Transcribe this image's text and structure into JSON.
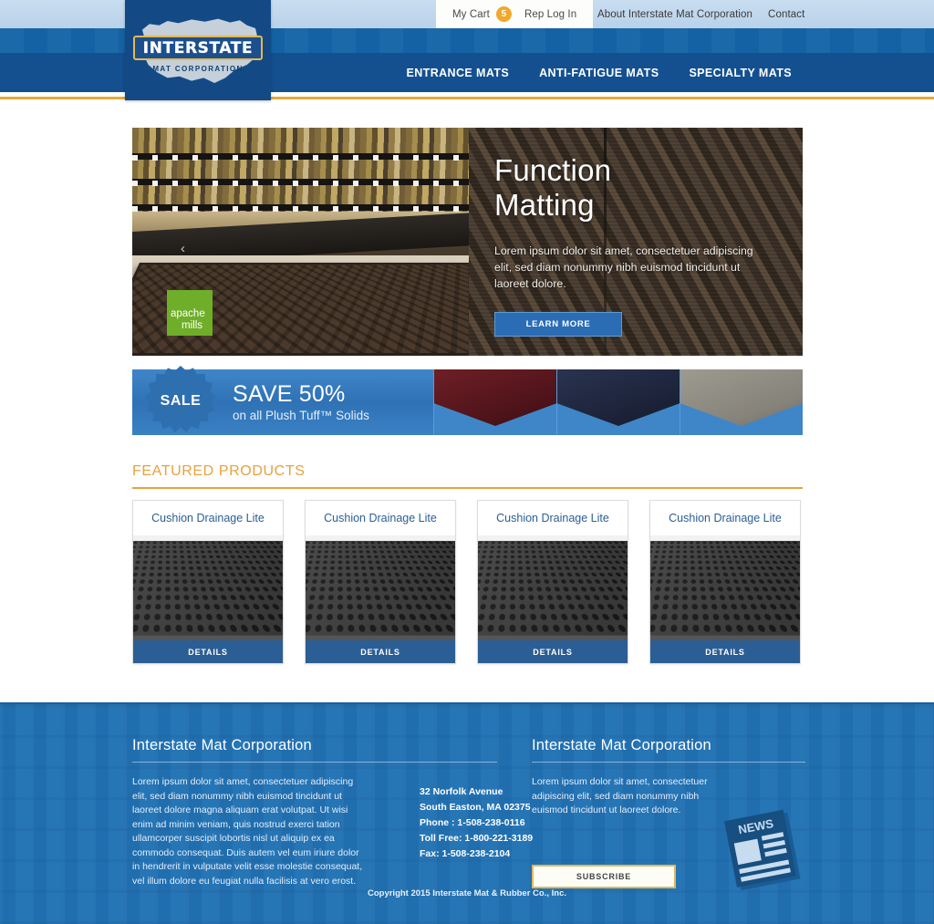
{
  "brand": {
    "logo_word": "INTERSTATE",
    "logo_sub": "MAT CORPORATION"
  },
  "colors": {
    "header_light": "#bfd6ec",
    "header_mid": "#1565a8",
    "nav_blue": "#14508f",
    "gold_rule": "#e8a93a",
    "accent_orange": "#e9a13b",
    "button_blue": "#2b5e94",
    "footer_blue": "#2272b4",
    "cart_badge": "#f0a92b"
  },
  "utility_nav": {
    "cart_label": "My Cart",
    "cart_count": "5",
    "rep_login": "Rep Log In",
    "about": "About Interstate Mat Corporation",
    "contact": "Contact"
  },
  "main_nav": {
    "items": [
      {
        "label": "ENTRANCE MATS"
      },
      {
        "label": "ANTI-FATIGUE MATS"
      },
      {
        "label": "SPECIALTY MATS"
      }
    ]
  },
  "hero": {
    "title_line1": "Function",
    "title_line2": "Matting",
    "description": "Lorem ipsum dolor sit amet, consectetuer adipiscing elit, sed diam nonummy nibh euismod tincidunt ut laoreet dolore.",
    "cta_label": "LEARN MORE",
    "prev_arrow": "‹",
    "partner_logo_line1": "apache",
    "partner_logo_line2": "mills"
  },
  "sale_banner": {
    "badge": "SALE",
    "headline": "SAVE 50%",
    "subline": "on all Plush Tuff™ Solids",
    "swatches": [
      {
        "name": "maroon-mat-swatch"
      },
      {
        "name": "navy-mat-swatch"
      },
      {
        "name": "gray-mat-swatch"
      }
    ]
  },
  "featured": {
    "title": "FEATURED PRODUCTS",
    "products": [
      {
        "name": "Cushion Drainage Lite",
        "button": "DETAILS"
      },
      {
        "name": "Cushion Drainage Lite",
        "button": "DETAILS"
      },
      {
        "name": "Cushion Drainage Lite",
        "button": "DETAILS"
      },
      {
        "name": "Cushion Drainage Lite",
        "button": "DETAILS"
      }
    ]
  },
  "footer": {
    "left": {
      "heading": "Interstate Mat Corporation",
      "body": "Lorem ipsum dolor sit amet, consectetuer adipiscing elit, sed diam nonummy nibh euismod tincidunt ut laoreet dolore magna aliquam erat volutpat. Ut wisi enim ad minim veniam, quis nostrud exerci tation ullamcorper suscipit lobortis nisl ut aliquip ex ea commodo consequat. Duis autem vel eum iriure dolor in hendrerit in vulputate velit esse molestie consequat, vel illum dolore eu feugiat nulla facilisis at vero erost."
    },
    "address": {
      "street": "32 Norfolk Avenue",
      "city": "South Easton, MA 02375",
      "phone": "Phone : 1-508-238-0116",
      "toll_free": "Toll Free: 1-800-221-3189",
      "fax": "Fax: 1-508-238-2104"
    },
    "right": {
      "heading": "Interstate Mat Corporation",
      "body": "Lorem ipsum dolor sit amet, consectetuer adipiscing elit, sed diam nonummy nibh euismod tincidunt ut laoreet dolore.",
      "subscribe_label": "SUBSCRIBE",
      "news_icon_text": "NEWS"
    },
    "copyright": "Copyright 2015 Interstate Mat & Rubber Co., Inc."
  }
}
